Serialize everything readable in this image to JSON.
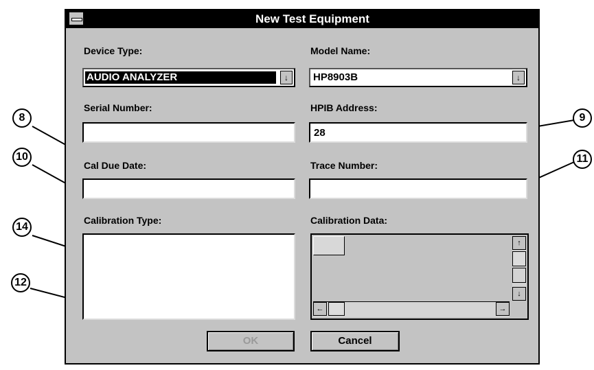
{
  "dialog": {
    "title": "New Test Equipment",
    "device_type": {
      "label": "Device Type:",
      "value": "AUDIO ANALYZER"
    },
    "model_name": {
      "label": "Model Name:",
      "value": "HP8903B"
    },
    "serial_number": {
      "label": "Serial Number:",
      "value": ""
    },
    "hpib_address": {
      "label": "HPIB Address:",
      "value": "28"
    },
    "cal_due_date": {
      "label": "Cal Due Date:",
      "value": ""
    },
    "trace_number": {
      "label": "Trace Number:",
      "value": ""
    },
    "calibration_type": {
      "label": "Calibration Type:"
    },
    "calibration_data": {
      "label": "Calibration Data:"
    },
    "ok_label": "OK",
    "cancel_label": "Cancel"
  },
  "callouts": [
    "8",
    "9",
    "10",
    "11",
    "14",
    "12"
  ],
  "icons": {
    "dropdown": "↓",
    "scroll_up": "↑",
    "scroll_down": "↓",
    "scroll_left": "←",
    "scroll_right": "→"
  }
}
